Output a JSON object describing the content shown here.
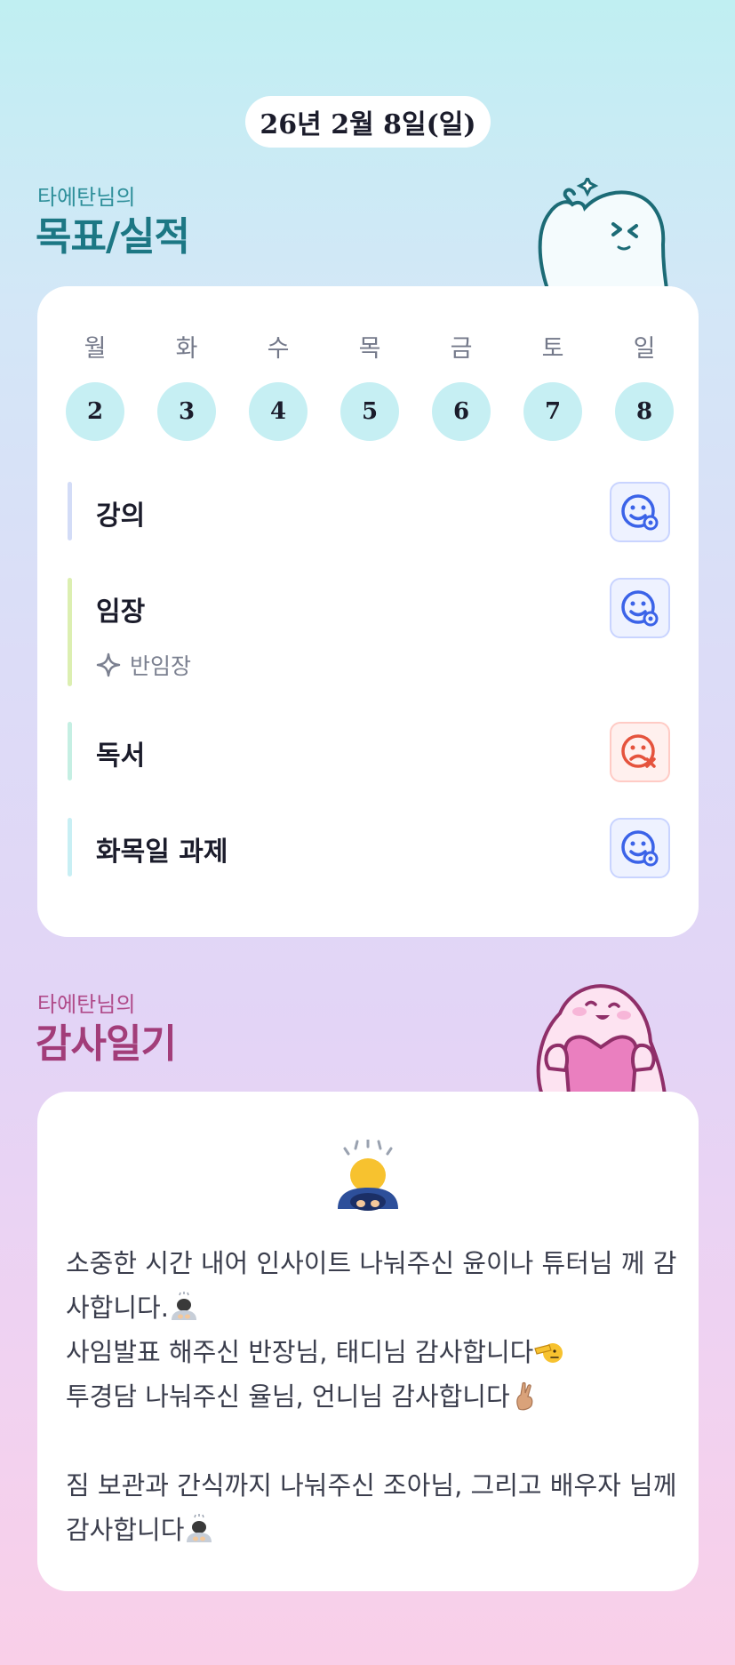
{
  "date": "26년 2월 8일(일)",
  "goals_section": {
    "subtitle": "타에탄님의",
    "title": "목표/실적"
  },
  "week": {
    "weekdays": [
      "월",
      "화",
      "수",
      "목",
      "금",
      "토",
      "일"
    ],
    "days": [
      "2",
      "3",
      "4",
      "5",
      "6",
      "7",
      "8"
    ]
  },
  "goals": [
    {
      "label": "강의",
      "status": "done",
      "bar_color": "#d3dcf7",
      "status_icon": "smile-check-icon"
    },
    {
      "label": "임장",
      "sub": "반임장",
      "sub_icon": "sparkle-icon",
      "status": "done",
      "bar_color": "#dcefb1",
      "status_icon": "smile-check-icon"
    },
    {
      "label": "독서",
      "status": "missed",
      "bar_color": "#c5efe3",
      "status_icon": "sad-x-icon"
    },
    {
      "label": "화목일 과제",
      "status": "done",
      "bar_color": "#c8eff4",
      "status_icon": "smile-check-icon"
    }
  ],
  "thanks_section": {
    "subtitle": "타에탄님의",
    "title": "감사일기"
  },
  "thanks": {
    "header_emoji": "bowing-person-icon",
    "line1": "소중한 시간 내어 인사이트 나눠주신 윤이나 튜터님 께 감사합니다.",
    "line2": "사임발표 해주신 반장님, 태디님 감사합니다",
    "line3": "투경담 나눠주신 율님, 언니님 감사합니다",
    "line4": "짐 보관과 간식까지 나눠주신 조아님, 그리고 배우자 님께 감사합니다"
  },
  "colors": {
    "goal_accent": "#1c7784",
    "thanks_accent": "#a23d79",
    "day_circle": "#c6eff3",
    "status_good": "#3b63e8",
    "status_bad": "#e5533d"
  }
}
